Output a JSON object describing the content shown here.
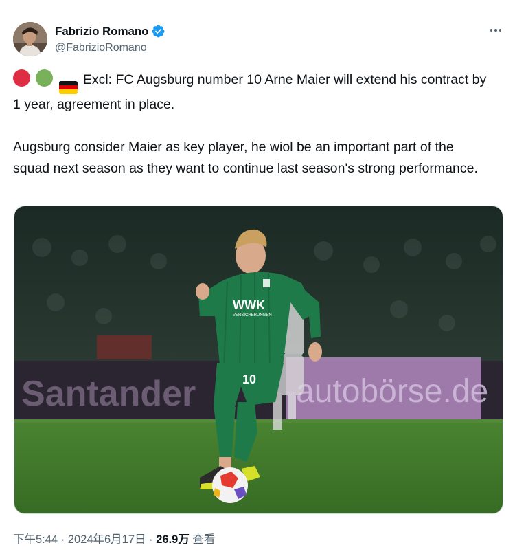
{
  "author": {
    "name": "Fabrizio Romano",
    "handle": "@FabrizioRomano",
    "verified": true
  },
  "tweet": {
    "paragraph1": "Excl: FC Augsburg number 10 Arne Maier will extend his contract by 1 year, agreement in place.",
    "paragraph2": "Augsburg consider Maier as key player, he wiol be an important part of the squad next season as they want to continue last season's strong performance.",
    "emojis": [
      "red-circle-icon",
      "green-circle-icon",
      "germany-flag-icon"
    ]
  },
  "media": {
    "jersey_sponsor": "WWK",
    "jersey_sponsor_sub": "VERSICHERUNGEN",
    "shirt_number": "10",
    "board_left": "Santander",
    "board_right": "autobörse.de"
  },
  "footer": {
    "time": "下午5:44",
    "sep1": " · ",
    "date": "2024年6月17日",
    "sep2": " · ",
    "views_count": "26.9万",
    "views_label": " 查看"
  },
  "colors": {
    "verified": "#1d9bf0",
    "secondary_text": "#536471",
    "primary_text": "#0f1419",
    "jersey": "#1f7a4a",
    "pitch": "#3f7a2a"
  }
}
